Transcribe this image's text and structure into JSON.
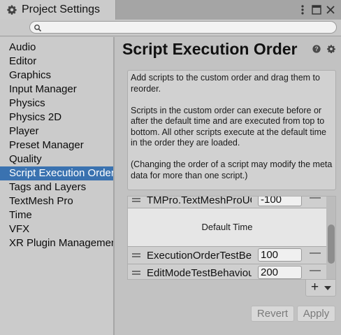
{
  "window": {
    "title": "Project Settings"
  },
  "search": {
    "value": "",
    "placeholder": ""
  },
  "sidebar": {
    "items": [
      {
        "label": "Audio",
        "selected": false
      },
      {
        "label": "Editor",
        "selected": false
      },
      {
        "label": "Graphics",
        "selected": false
      },
      {
        "label": "Input Manager",
        "selected": false
      },
      {
        "label": "Physics",
        "selected": false
      },
      {
        "label": "Physics 2D",
        "selected": false
      },
      {
        "label": "Player",
        "selected": false
      },
      {
        "label": "Preset Manager",
        "selected": false
      },
      {
        "label": "Quality",
        "selected": false
      },
      {
        "label": "Script Execution Order",
        "selected": true
      },
      {
        "label": "Tags and Layers",
        "selected": false
      },
      {
        "label": "TextMesh Pro",
        "selected": false
      },
      {
        "label": "Time",
        "selected": false
      },
      {
        "label": "VFX",
        "selected": false
      },
      {
        "label": "XR Plugin Management",
        "selected": false
      }
    ]
  },
  "main": {
    "title": "Script Execution Order",
    "info": {
      "p1": "Add scripts to the custom order and drag them to reorder.",
      "p2": "Scripts in the custom order can execute before or after the default time and are executed from top to bottom. All other scripts execute at the default time in the order they are loaded.",
      "p3": "(Changing the order of a script may modify the meta data for more than one script.)"
    },
    "rows_before": [
      {
        "name": "TMPro.TextMeshProUGUI",
        "order": "-100"
      }
    ],
    "default_time_label": "Default Time",
    "rows_after": [
      {
        "name": "ExecutionOrderTestBehaviour",
        "order": "100"
      },
      {
        "name": "EditModeTestBehaviour",
        "order": "200"
      }
    ],
    "add_label": "+",
    "remove_label": "—",
    "revert_label": "Revert",
    "apply_label": "Apply"
  },
  "colors": {
    "selection": "#3a72b0",
    "panel": "#c2c2c2"
  },
  "icons": [
    "gear-icon",
    "menu-dots-icon",
    "maximize-icon",
    "close-icon",
    "search-icon",
    "help-icon",
    "settings-icon",
    "drag-handle-icon"
  ]
}
